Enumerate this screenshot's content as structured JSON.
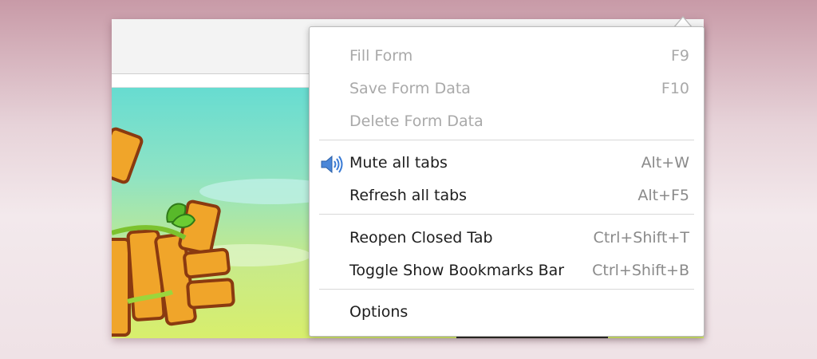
{
  "menu": {
    "items": [
      {
        "label": "Fill Form",
        "shortcut": "F9",
        "enabled": false
      },
      {
        "label": "Save Form Data",
        "shortcut": "F10",
        "enabled": false
      },
      {
        "label": "Delete Form Data",
        "shortcut": "",
        "enabled": false
      },
      {
        "label": "Mute all tabs",
        "shortcut": "Alt+W",
        "enabled": true,
        "icon": "speaker-icon"
      },
      {
        "label": "Refresh all tabs",
        "shortcut": "Alt+F5",
        "enabled": true
      },
      {
        "label": "Reopen Closed Tab",
        "shortcut": "Ctrl+Shift+T",
        "enabled": true
      },
      {
        "label": "Toggle Show Bookmarks Bar",
        "shortcut": "Ctrl+Shift+B",
        "enabled": true
      },
      {
        "label": "Options",
        "shortcut": "",
        "enabled": true
      }
    ]
  },
  "colors": {
    "background_top": "#c89aa7",
    "content_sky": "#67dcd1",
    "content_grass": "#d8ee6c",
    "disabled_text": "#a9a9a9",
    "shortcut_text": "#8a8a8a",
    "speaker_icon": "#3a7bd5"
  }
}
